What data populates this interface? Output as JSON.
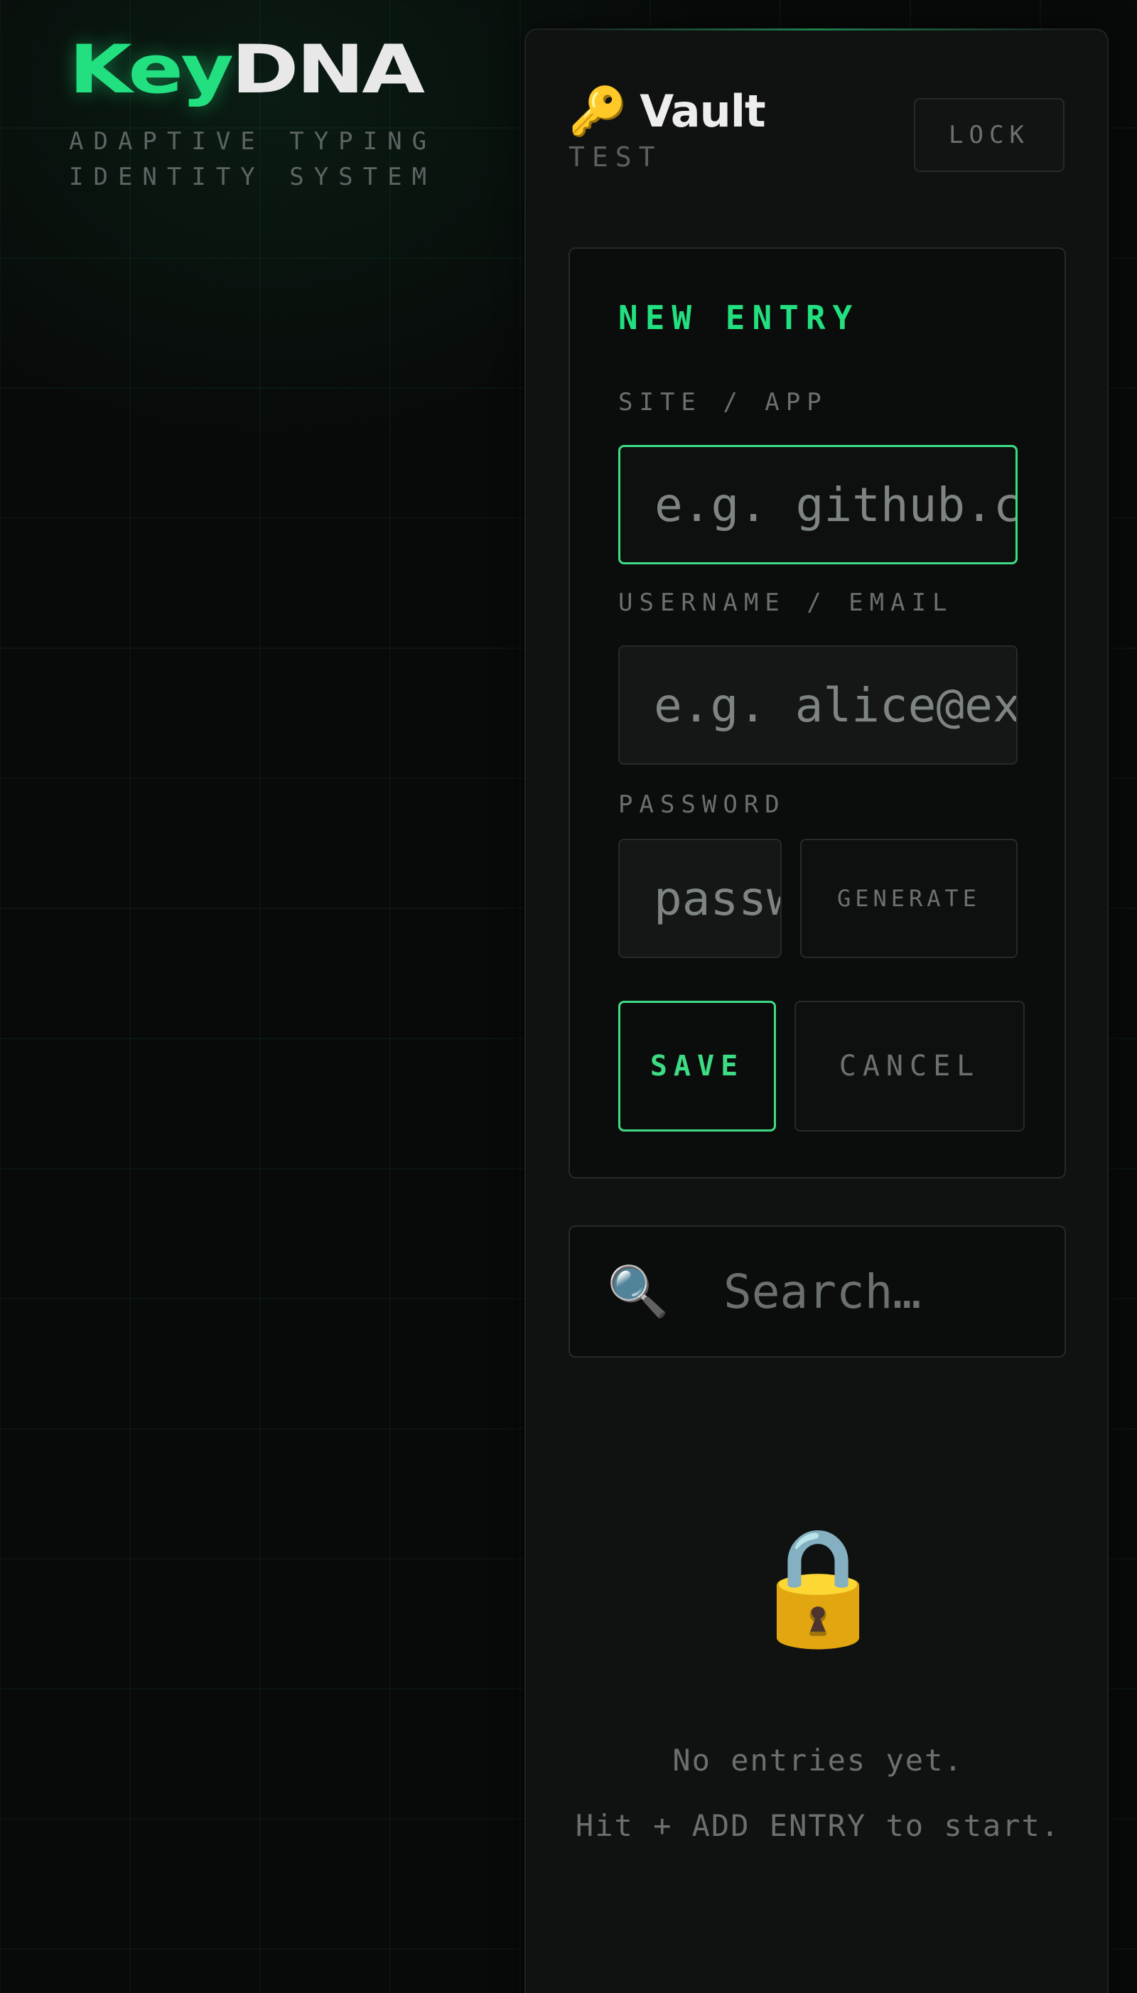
{
  "brand": {
    "logo_part1": "Key",
    "logo_part2": "DNA",
    "tagline": "ADAPTIVE TYPING\nIDENTITY SYSTEM"
  },
  "vault": {
    "icon": "key-icon",
    "title": "Vault",
    "user": "TEST",
    "lock_label": "LOCK"
  },
  "form": {
    "title": "NEW ENTRY",
    "site_label": "SITE / APP",
    "site_placeholder": "e.g. github.com",
    "username_label": "USERNAME / EMAIL",
    "username_placeholder": "e.g. alice@example.com",
    "password_label": "PASSWORD",
    "password_placeholder": "password",
    "generate_label": "GENERATE",
    "save_label": "SAVE",
    "cancel_label": "CANCEL"
  },
  "search": {
    "icon": "search-icon",
    "placeholder": "Search…"
  },
  "empty": {
    "icon": "lock-icon",
    "line1": "No entries yet.",
    "line2": "Hit + ADD ENTRY to start."
  },
  "colors": {
    "accent": "#22e07f",
    "background": "#080a09",
    "panel": "#101211"
  }
}
